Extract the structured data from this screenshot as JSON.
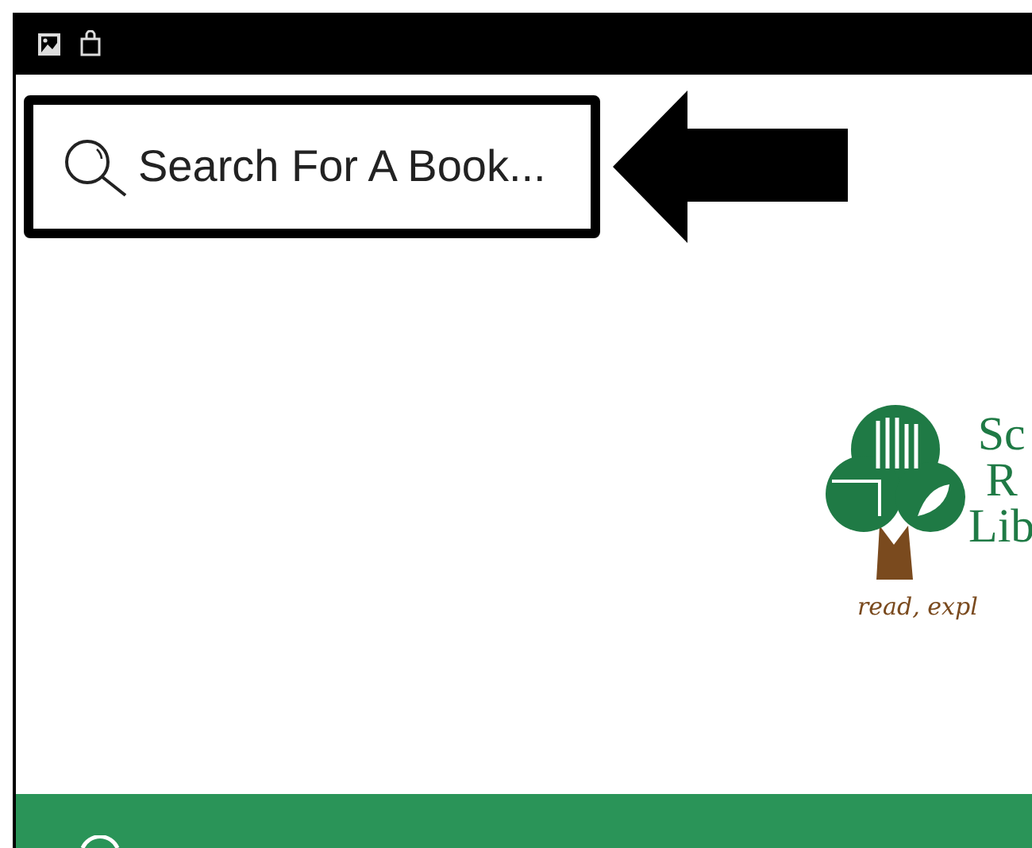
{
  "search": {
    "placeholder": "Search For A Book..."
  },
  "logo": {
    "lines": [
      "Sc",
      "R",
      "Lib"
    ],
    "tagline": "read, expl"
  }
}
